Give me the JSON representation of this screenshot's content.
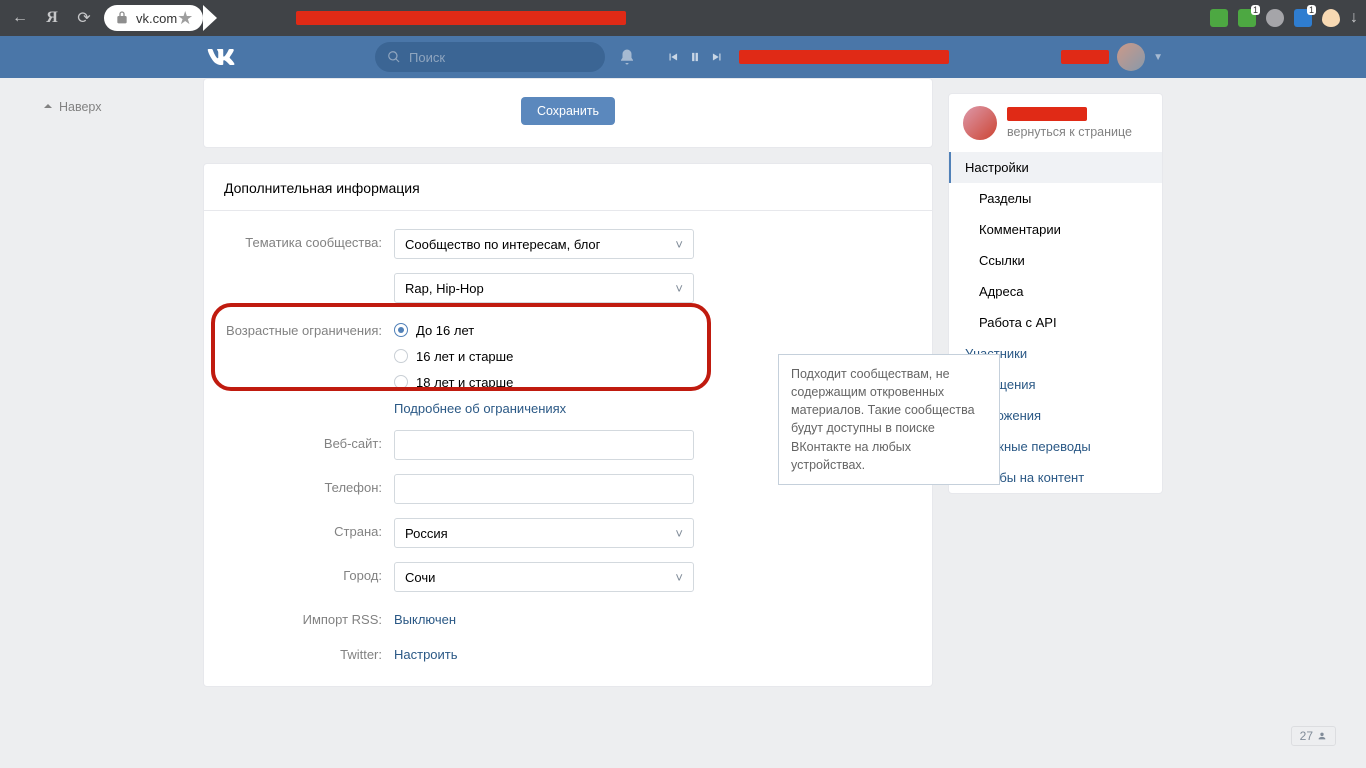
{
  "browser": {
    "address": "vk.com",
    "ext_badge": "1"
  },
  "header": {
    "search_placeholder": "Поиск"
  },
  "top_link": "Наверх",
  "save_btn": "Сохранить",
  "section_title": "Дополнительная информация",
  "form": {
    "theme_label": "Тематика сообщества:",
    "theme_value": "Сообщество по интересам, блог",
    "subtheme_value": "Rap, Hip-Hop",
    "age_label": "Возрастные ограничения:",
    "age_options": {
      "a": "До 16 лет",
      "b": "16 лет и старше",
      "c": "18 лет и старше"
    },
    "age_more": "Подробнее об ограничениях",
    "website_label": "Веб-сайт:",
    "phone_label": "Телефон:",
    "country_label": "Страна:",
    "country_value": "Россия",
    "city_label": "Город:",
    "city_value": "Сочи",
    "rss_label": "Импорт RSS:",
    "rss_value": "Выключен",
    "twitter_label": "Twitter:",
    "twitter_value": "Настроить"
  },
  "tooltip": "Подходит сообществам, не содержащим откровенных материалов. Такие сообщества будут доступны в поиске ВКонтакте на любых устройствах.",
  "side": {
    "back": "вернуться к странице",
    "nav": {
      "settings": "Настройки",
      "sections": "Разделы",
      "comments": "Комментарии",
      "links": "Ссылки",
      "addresses": "Адреса",
      "api": "Работа с API",
      "members": "Участники",
      "messages": "Сообщения",
      "apps": "Приложения",
      "money": "Денежные переводы",
      "reports": "Жалобы на контент"
    }
  },
  "counter": "27"
}
